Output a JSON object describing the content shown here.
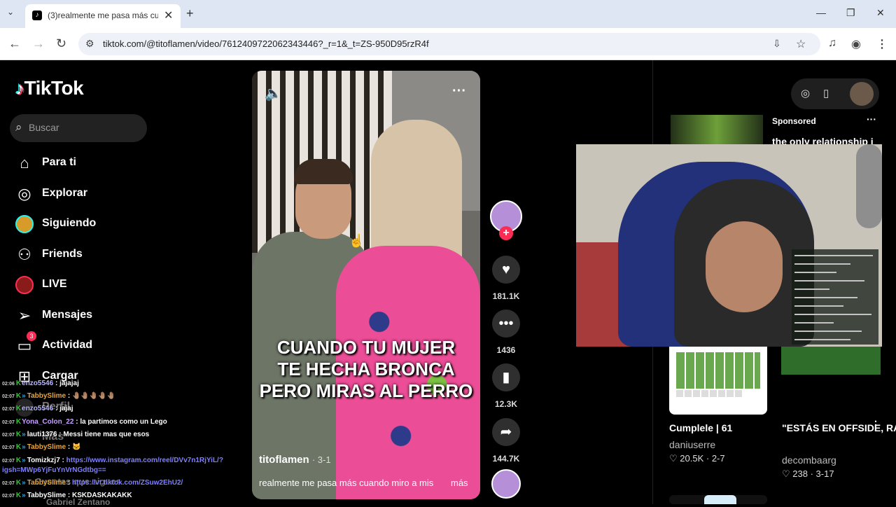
{
  "browser": {
    "tab_title": "(3)realmente me pasa más cuando",
    "url": "tiktok.com/@titoflamen/video/7612409722062343446?_r=1&_t=ZS-950D95rzR4f"
  },
  "sidebar": {
    "logo": "TikTok",
    "search_placeholder": "Buscar",
    "items": [
      {
        "label": "Para ti"
      },
      {
        "label": "Explorar"
      },
      {
        "label": "Siguiendo"
      },
      {
        "label": "Friends"
      },
      {
        "label": "LIVE"
      },
      {
        "label": "Mensajes"
      },
      {
        "label": "Actividad",
        "badge": "3"
      },
      {
        "label": "Cargar"
      },
      {
        "label": "Perfil"
      },
      {
        "label": "Más"
      }
    ],
    "following_heading": "Cuentas que sigues",
    "following_first": "Gabriel Zentano"
  },
  "chat": [
    {
      "time": "02:06",
      "user": "enzo5546",
      "msg": "jajajaj"
    },
    {
      "time": "02:07",
      "user": "TabbySlime",
      "msg": "🤚🏽🤚🏽🤚🏽🤚🏽🤚🏽"
    },
    {
      "time": "02:07",
      "user": "enzo5546",
      "msg": "jajaj"
    },
    {
      "time": "02:07",
      "user": "Yona_Colon_22",
      "msg": "la partimos como un Lego"
    },
    {
      "time": "02:07",
      "user": "lauti1376",
      "msg": "Messi tiene mas que esos"
    },
    {
      "time": "02:07",
      "user": "TabbySlime",
      "msg": "🐱"
    },
    {
      "time": "02:07",
      "user": "Tomizkzj7",
      "msg": "https://www.instagram.com/reel/DVv7n1RjYiL/?"
    },
    {
      "time": "",
      "user": "",
      "msg": "igsh=MWp6YjFuYnVrNGdtbg=="
    },
    {
      "time": "02:07",
      "user": "TabbySlime",
      "msg": "https://vt.tiktok.com/ZSuw2EhU2/"
    },
    {
      "time": "02:07",
      "user": "TabbySlime",
      "msg": "KSKDASKAKAKK"
    }
  ],
  "video": {
    "caption_lines": [
      "CUANDO TU MUJER",
      "TE HECHA BRONCA",
      "PERO MIRAS AL PERRO"
    ],
    "author": "titoflamen",
    "date": "· 3-1",
    "description": "realmente me pasa más cuando miro a mis",
    "more": "más"
  },
  "actions": {
    "likes": "181.1K",
    "comments": "1436",
    "saves": "12.3K",
    "shares": "144.7K"
  },
  "ad": {
    "sponsored": "Sponsored",
    "text": "the only relationship i"
  },
  "cards": [
    {
      "title": "Cumplele | 61",
      "author": "daniuserre",
      "likes": "20.5K",
      "date": "· 2-7"
    },
    {
      "title": "\"ESTÁS EN OFFSIDE, RAMÓ...",
      "author": "decombaarg",
      "likes": "238",
      "date": "· 3-17"
    }
  ]
}
